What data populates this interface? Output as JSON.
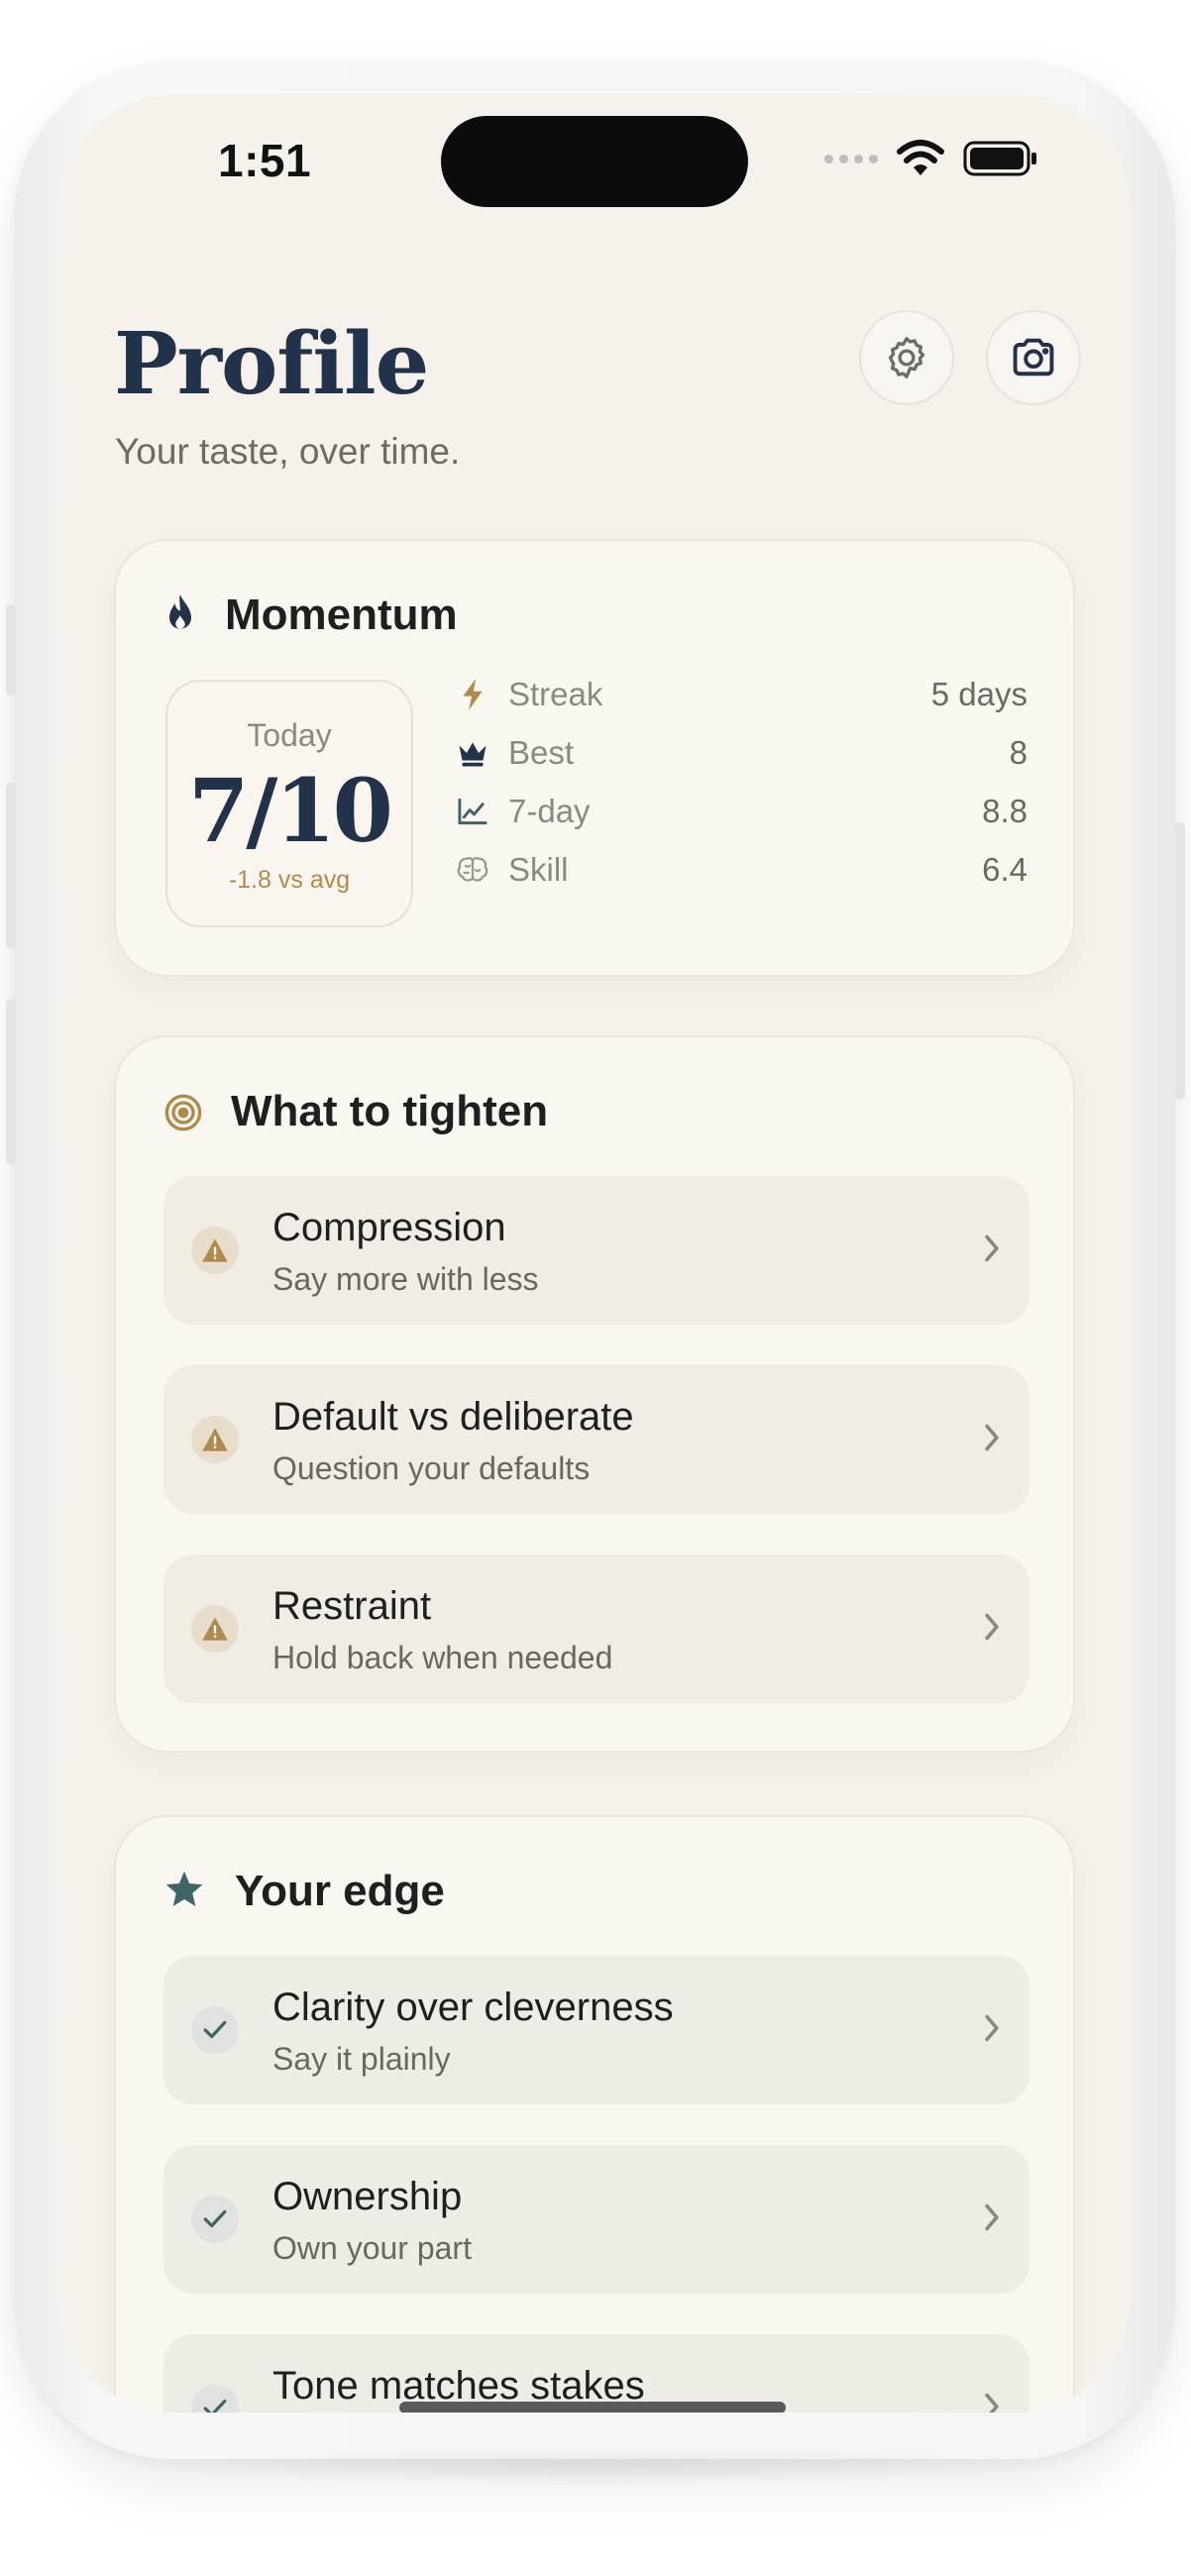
{
  "status_bar": {
    "time": "1:51"
  },
  "header": {
    "title": "Profile",
    "subtitle": "Your taste, over time."
  },
  "momentum": {
    "title": "Momentum",
    "today": {
      "label": "Today",
      "score": "7/10",
      "delta": "-1.8 vs avg"
    },
    "stats": [
      {
        "icon": "bolt-icon",
        "label": "Streak",
        "value": "5 days"
      },
      {
        "icon": "crown-icon",
        "label": "Best",
        "value": "8"
      },
      {
        "icon": "trend-chart-icon",
        "label": "7-day",
        "value": "8.8"
      },
      {
        "icon": "brain-icon",
        "label": "Skill",
        "value": "6.4"
      }
    ]
  },
  "tighten": {
    "title": "What to tighten",
    "items": [
      {
        "title": "Compression",
        "subtitle": "Say more with less"
      },
      {
        "title": "Default vs deliberate",
        "subtitle": "Question your defaults"
      },
      {
        "title": "Restraint",
        "subtitle": "Hold back when needed"
      }
    ]
  },
  "edge": {
    "title": "Your edge",
    "items": [
      {
        "title": "Clarity over cleverness",
        "subtitle": "Say it plainly"
      },
      {
        "title": "Ownership",
        "subtitle": "Own your part"
      },
      {
        "title": "Tone matches stakes",
        "subtitle": ""
      }
    ]
  },
  "colors": {
    "navy": "#22324a",
    "warning": "#b08a4a",
    "teal": "#3f6468",
    "background": "#f6f2eb"
  }
}
